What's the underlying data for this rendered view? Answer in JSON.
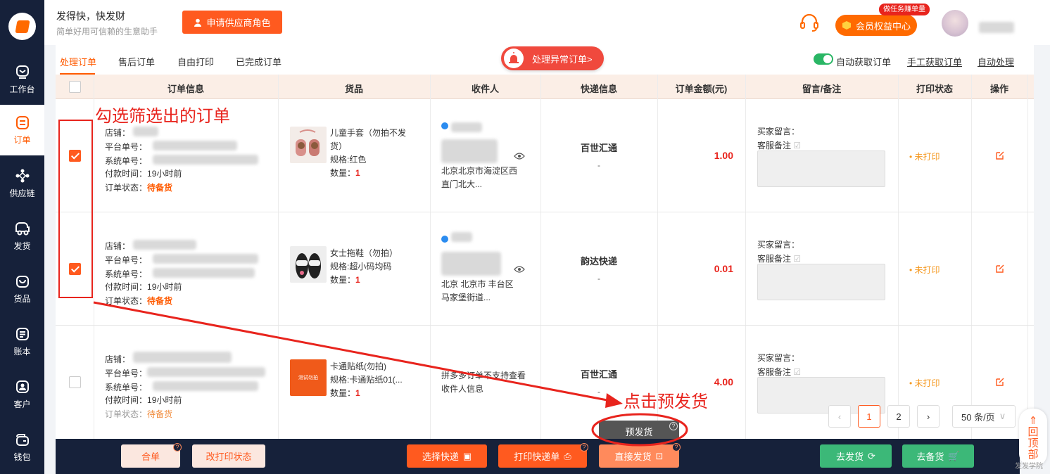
{
  "sidebar": {
    "items": [
      {
        "label": "工作台",
        "icon": "dashboard-icon"
      },
      {
        "label": "订单",
        "icon": "order-icon",
        "active": true
      },
      {
        "label": "供应链",
        "icon": "supply-chain-icon"
      },
      {
        "label": "发货",
        "icon": "delivery-truck-icon"
      },
      {
        "label": "货品",
        "icon": "goods-bag-icon"
      },
      {
        "label": "账本",
        "icon": "ledger-icon"
      },
      {
        "label": "客户",
        "icon": "customer-icon"
      },
      {
        "label": "钱包",
        "icon": "wallet-icon"
      }
    ]
  },
  "header": {
    "title": "发得快，快发财",
    "subtitle": "简单好用可信赖的生意助手",
    "apply_supplier_label": "申请供应商角色",
    "member_label": "会员权益中心",
    "member_badge": "做任务赚单量"
  },
  "tabs": {
    "items": [
      "处理订单",
      "售后订单",
      "自由打印",
      "已完成订单"
    ],
    "abnormal_label": "处理异常订单>",
    "auto_fetch_label": "自动获取订单",
    "manual_fetch_label": "手工获取订单",
    "auto_process_label": "自动处理"
  },
  "table": {
    "headers": [
      "订单信息",
      "货品",
      "收件人",
      "快递信息",
      "订单金额(元)",
      "留言/备注",
      "打印状态",
      "操作"
    ],
    "field_labels": {
      "shop": "店铺：",
      "platform_no": "平台单号：",
      "system_no": "系统单号：",
      "pay_time": "付款时间：",
      "status": "订单状态：",
      "quantity": "数量：",
      "buyer_msg": "买家留言：",
      "service_note": "客服备注"
    },
    "rows": [
      {
        "checked": true,
        "pay_time": "19小时前",
        "status": "待备货",
        "product_name": "儿童手套（勿拍不发货）",
        "product_spec": "规格:红色",
        "quantity": "1",
        "address": "北京北京市海淀区西直门北大...",
        "courier": "百世汇通",
        "courier_no": "-",
        "amount": "1.00",
        "print_status": "• 未打印"
      },
      {
        "checked": true,
        "pay_time": "19小时前",
        "status": "待备货",
        "product_name": "女士拖鞋（勿拍）",
        "product_spec": "规格:超小码均码",
        "quantity": "1",
        "address": "北京 北京市 丰台区马家堡街道...",
        "courier": "韵达快递",
        "courier_no": "-",
        "amount": "0.01",
        "print_status": "• 未打印"
      },
      {
        "checked": false,
        "pay_time": "19小时前",
        "status": "待备货",
        "product_name": "卡通贴纸(勿拍)",
        "product_spec": "规格:卡通贴纸01(...",
        "quantity": "1",
        "product_img_text": "测试勿拍",
        "address": "拼多多订单不支持查看收件人信息",
        "courier": "百世汇通",
        "courier_no": "-",
        "amount": "4.00",
        "print_status": "• 未打印"
      }
    ]
  },
  "pagination": {
    "pages": [
      "1",
      "2"
    ],
    "current": "1",
    "page_size": "50 条/页"
  },
  "bottom_bar": {
    "merge_label": "合单",
    "change_print_label": "改打印状态",
    "select_courier_label": "选择快递",
    "print_waybill_label": "打印快递单",
    "direct_ship_label": "直接发货",
    "go_ship_label": "去发货",
    "go_stock_label": "去备货",
    "pre_ship_label": "预发货"
  },
  "back_top_label": "回顶部",
  "watermark": "发发学院",
  "annotations": {
    "select_hint": "勾选筛选出的订单",
    "click_hint": "点击预发货"
  },
  "colors": {
    "accent": "#ff5a1f",
    "sidebar": "#16213a",
    "danger": "#e8241d",
    "success": "#3cb878"
  }
}
